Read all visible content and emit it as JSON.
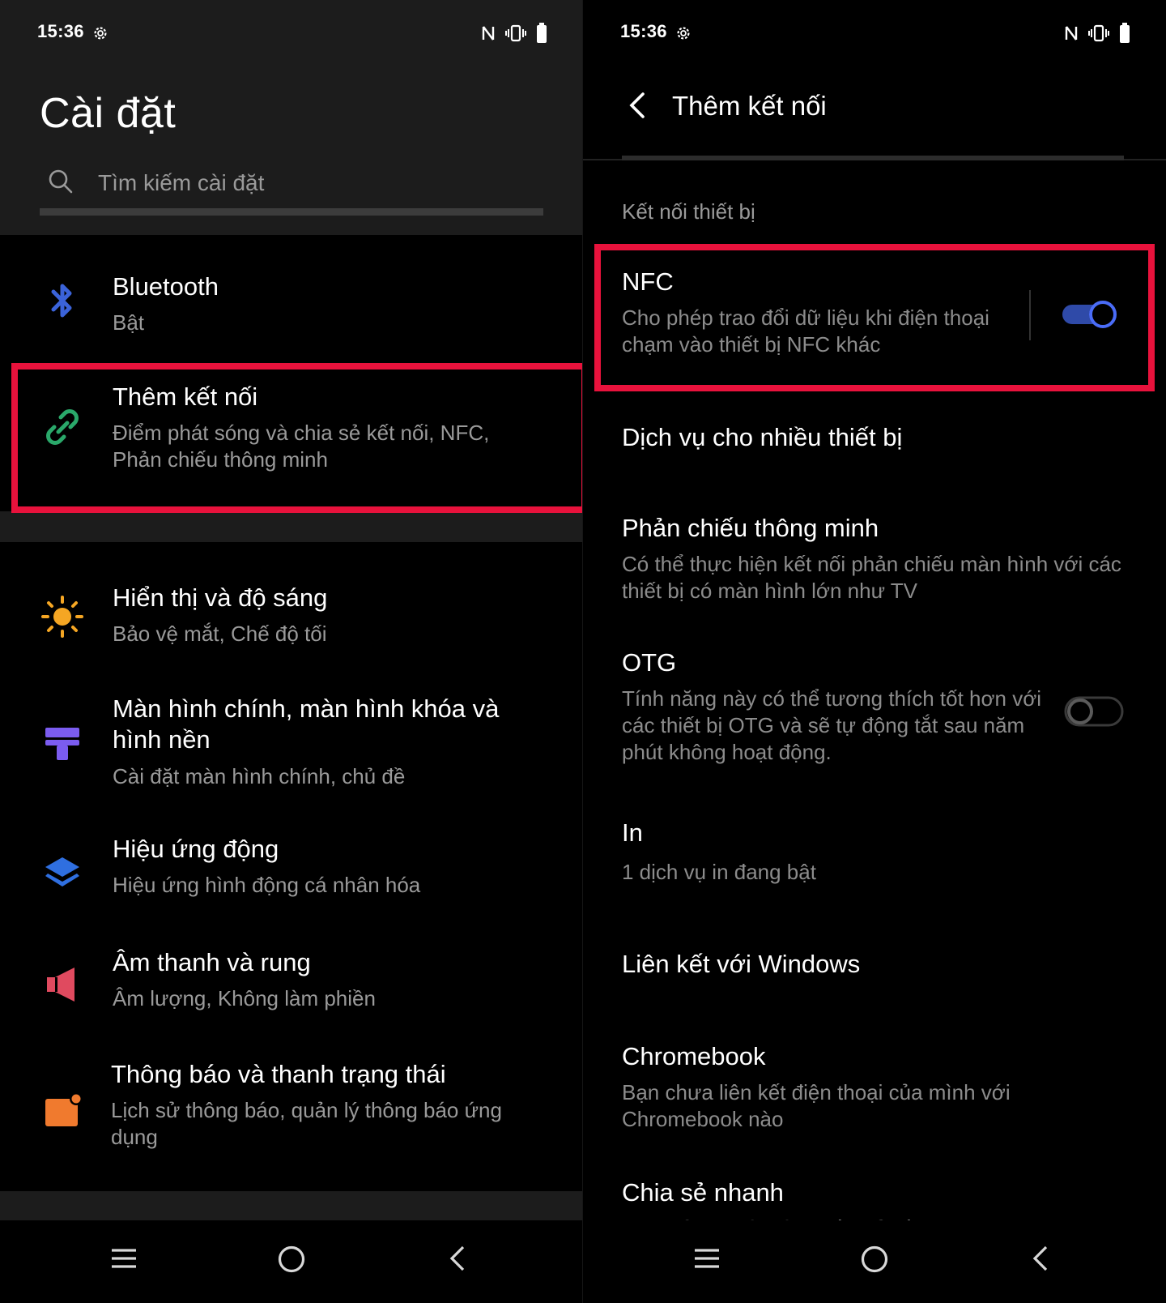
{
  "left": {
    "status": {
      "time": "15:36"
    },
    "title": "Cài đặt",
    "search": {
      "placeholder": "Tìm kiếm cài đặt"
    },
    "items": [
      {
        "icon": "bluetooth-icon",
        "title": "Bluetooth",
        "subtitle": "Bật",
        "icon_color": "#3b63d9"
      },
      {
        "icon": "link-icon",
        "title": "Thêm kết nối",
        "subtitle": "Điểm phát sóng và chia sẻ kết nối, NFC, Phản chiếu thông minh",
        "icon_color": "#2aa86a"
      },
      {
        "icon": "brightness-icon",
        "title": "Hiển thị và độ sáng",
        "subtitle": "Bảo vệ mắt, Chế độ tối",
        "icon_color": "#f5a623"
      },
      {
        "icon": "wallpaper-icon",
        "title": "Màn hình chính, màn hình khóa và hình nền",
        "subtitle": "Cài đặt màn hình chính, chủ đề",
        "icon_color": "#7b5cf0"
      },
      {
        "icon": "layers-icon",
        "title": "Hiệu ứng động",
        "subtitle": "Hiệu ứng hình động cá nhân hóa",
        "icon_color": "#2f6fe0"
      },
      {
        "icon": "speaker-icon",
        "title": "Âm thanh và rung",
        "subtitle": "Âm lượng, Không làm phiền",
        "icon_color": "#e04a5f"
      },
      {
        "icon": "notification-icon",
        "title": "Thông báo và thanh trạng thái",
        "subtitle": "Lịch sử thông báo, quản lý thông báo ứng dụng",
        "icon_color": "#f07a2e"
      }
    ]
  },
  "right": {
    "status": {
      "time": "15:36"
    },
    "title": "Thêm kết nối",
    "section": "Kết nối thiết bị",
    "nfc": {
      "title": "NFC",
      "subtitle": "Cho phép trao đổi dữ liệu khi điện thoại chạm vào thiết bị NFC khác",
      "enabled": true
    },
    "multi_device": {
      "title": "Dịch vụ cho nhiều thiết bị"
    },
    "mirror": {
      "title": "Phản chiếu thông minh",
      "subtitle": "Có thể thực hiện kết nối phản chiếu màn hình với các thiết bị có màn hình lớn như TV"
    },
    "otg": {
      "title": "OTG",
      "subtitle": "Tính năng này có thể tương thích tốt hơn với các thiết bị OTG và sẽ tự động tắt sau năm phút không hoạt động.",
      "enabled": false
    },
    "print": {
      "title": "In",
      "subtitle": "1 dịch vụ in đang bật"
    },
    "windows": {
      "title": "Liên kết với Windows"
    },
    "chromebook": {
      "title": "Chromebook",
      "subtitle": "Bạn chưa liên kết điện thoại của mình với Chromebook nào"
    },
    "quick_share": {
      "title": "Chia sẻ nhanh",
      "subtitle": "Chia sẻ tệp với các thiết bị ở gần"
    }
  },
  "colors": {
    "highlight": "#e8123c",
    "toggle_on": "#4a6cf7",
    "header_bg": "#1c1c1c"
  }
}
